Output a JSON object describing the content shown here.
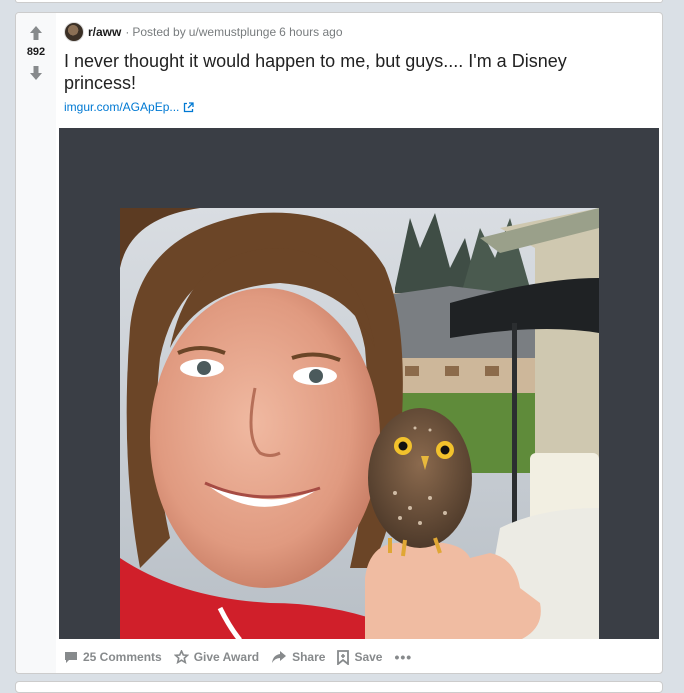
{
  "post": {
    "score": "892",
    "subreddit": "r/aww",
    "meta_separator": "·",
    "posted_by_prefix": "Posted by",
    "author": "u/wemustplunge",
    "time": "6 hours ago",
    "title": "I never thought it would happen to me, but guys.... I'm a Disney princess!",
    "link_text": "imgur.com/AGApEp..."
  },
  "actions": {
    "comments": "25 Comments",
    "award": "Give Award",
    "share": "Share",
    "save": "Save",
    "more": "•••"
  },
  "icons": {
    "upvote": "arrow-up-icon",
    "downvote": "arrow-down-icon",
    "external": "external-link-icon",
    "comment": "comment-icon",
    "award": "award-icon",
    "share": "share-icon",
    "save": "bookmark-icon"
  },
  "colors": {
    "page_bg": "#dae0e6",
    "link": "#0079d3",
    "muted": "#878a8c",
    "media_bg": "#3a3e45"
  }
}
